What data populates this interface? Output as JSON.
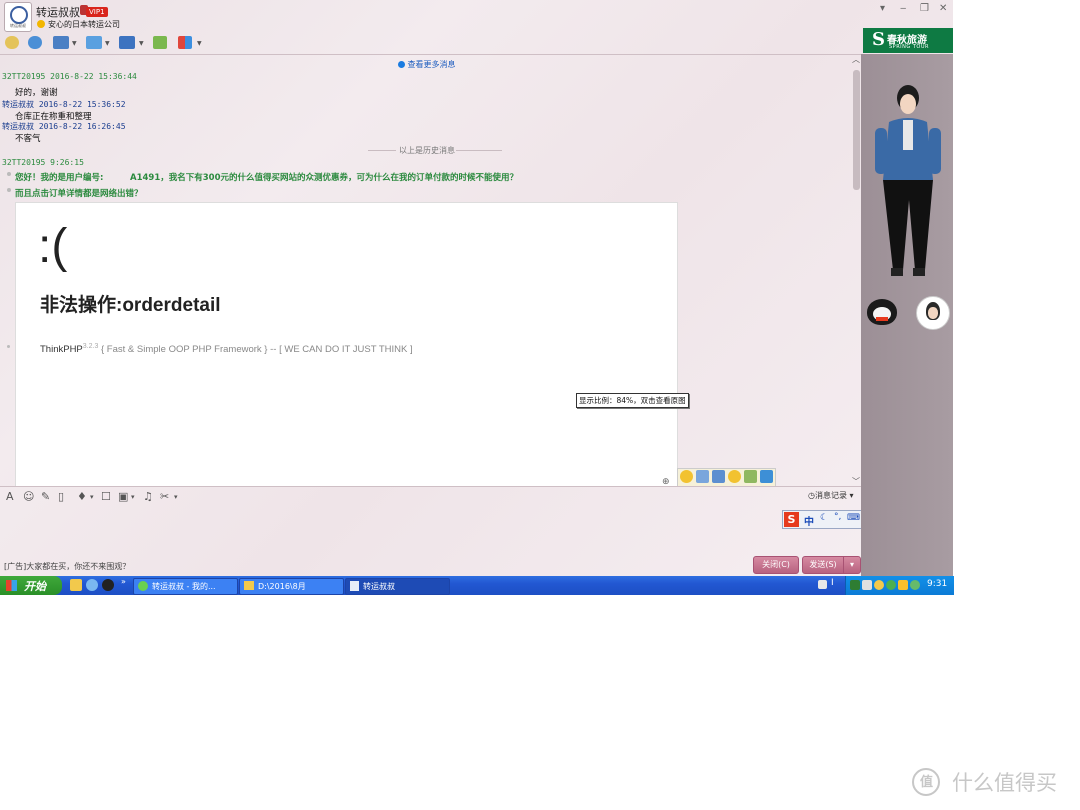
{
  "window": {
    "contact_name": "转运叔叔",
    "vip_badge": "VIP1",
    "signature": "安心的日本转运公司",
    "logo_text": "转运叔叔"
  },
  "chat": {
    "view_more": "查看更多消息",
    "history_divider": "以上是历史消息",
    "messages": [
      {
        "header": "32TT20195 2016-8-22 15:36:44",
        "text": "好的，谢谢"
      },
      {
        "header": "转运叔叔 2016-8-22 15:36:52",
        "text": "仓库正在称重和整理"
      },
      {
        "header": "转运叔叔 2016-8-22 16:26:45",
        "text": "不客气"
      },
      {
        "header": "32TT20195  9:26:15",
        "text": ""
      }
    ],
    "current_lines": [
      "您好！我的是用户编号:",
      "A1491，我名下有300元的什么值得买网站的众测优惠券，可为什么在我的订单付款的时候不能使用？",
      "而且点击订单详情都是网络出错？"
    ]
  },
  "error_page": {
    "face": ":(",
    "title": "非法操作:orderdetail",
    "framework": "ThinkPHP",
    "version": "3.2.3",
    "tagline": "{ Fast & Simple OOP PHP Framework } -- [ WE CAN DO IT JUST THINK ]"
  },
  "tooltip": "显示比例：84%，双击查看原图",
  "input_toolbar": {
    "history_label": "消息记录"
  },
  "ime": {
    "mode": "中"
  },
  "footer": {
    "ad_text": "[广告]大家都在买，你还不来围观？",
    "close_label": "关闭(C)",
    "send_label": "发送(S)"
  },
  "right_panel": {
    "brand_cn": "春秋旅游",
    "brand_en": "SPRING TOUR"
  },
  "taskbar": {
    "start_label": "开始",
    "tasks": [
      "转运叔叔 - 我的...",
      "D:\\2016\\8月",
      "转运叔叔"
    ],
    "clock": "9:31"
  },
  "watermark": "什么值得买",
  "colors": {
    "accent_green": "#2b8a3e",
    "brand_green": "#0e7a43",
    "button_pink": "#c46f8d",
    "taskbar_blue": "#2257d2"
  }
}
